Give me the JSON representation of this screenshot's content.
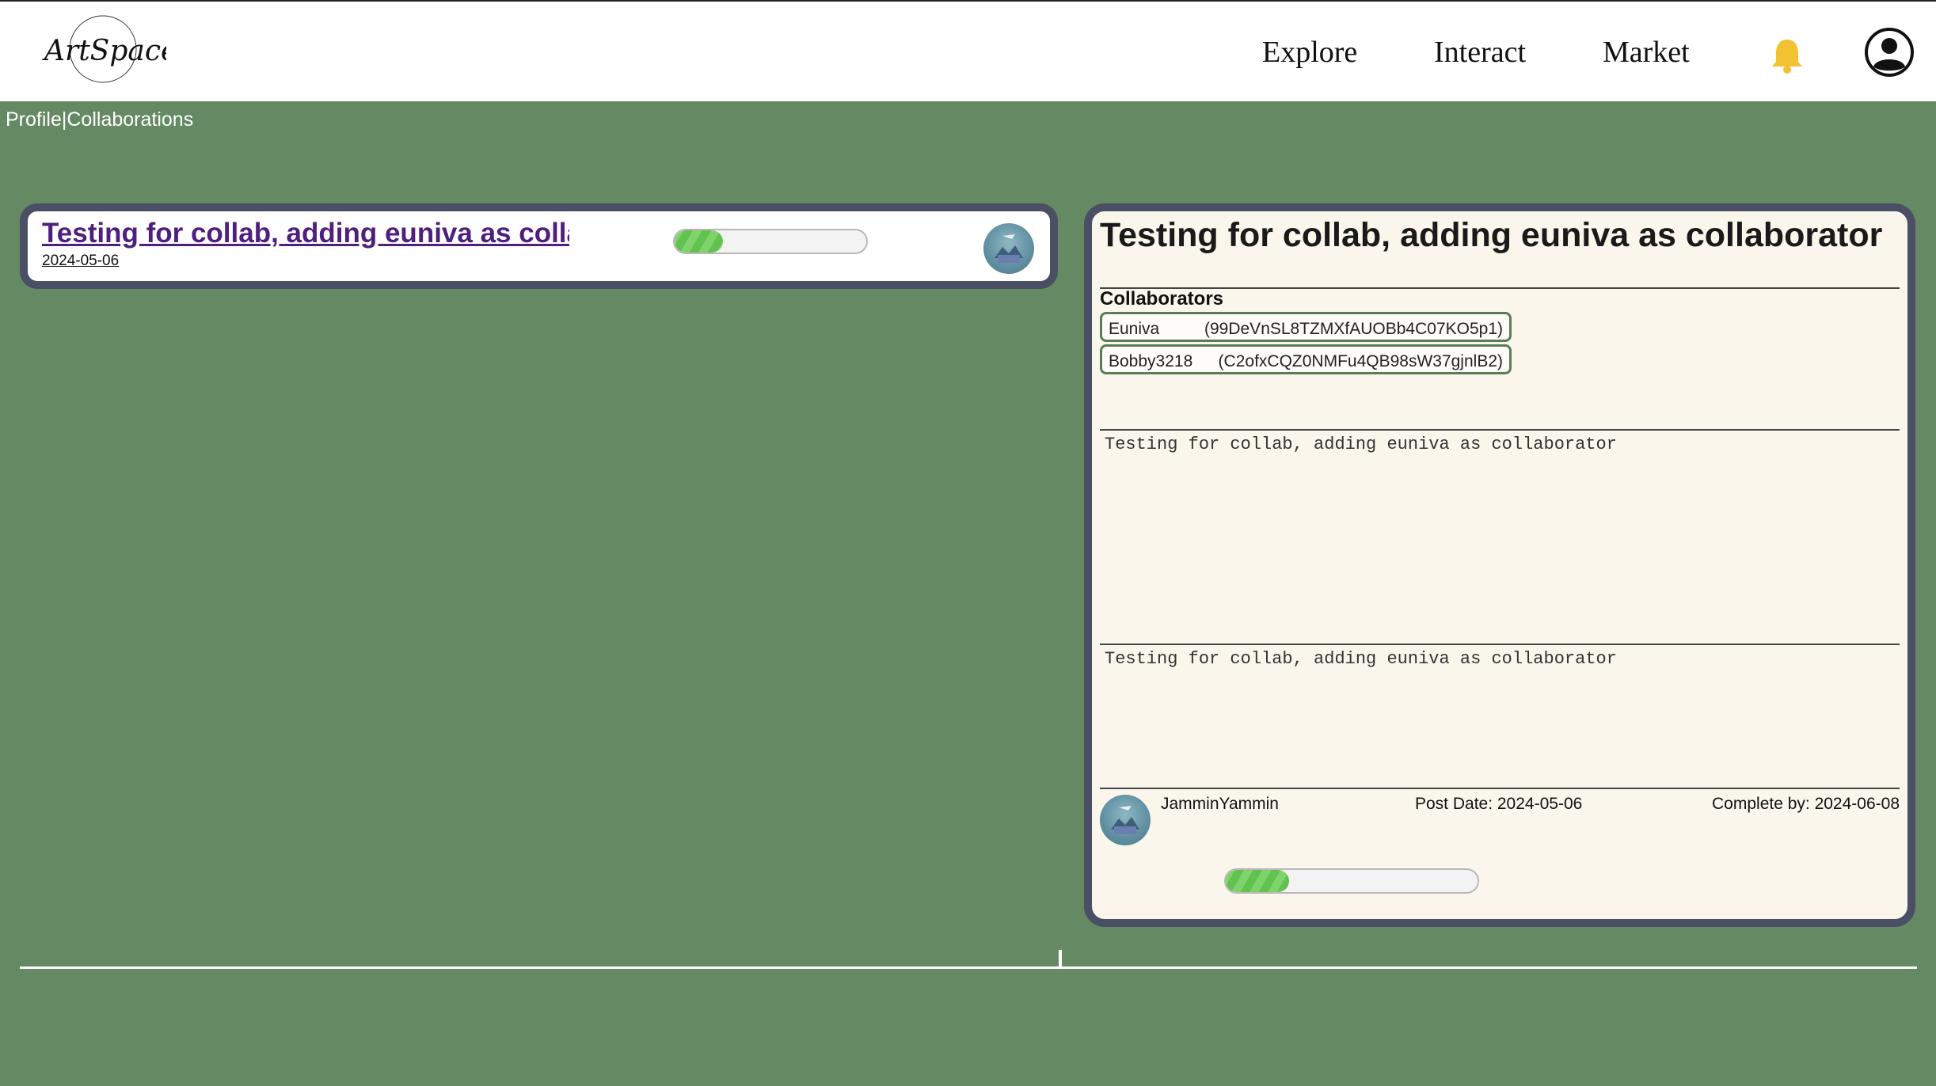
{
  "header": {
    "logo_text": "ArtSpace",
    "nav": [
      "Explore",
      "Interact",
      "Market"
    ]
  },
  "breadcrumb": {
    "profile": "Profile",
    "separator": "|",
    "collaborations": "Collaborations"
  },
  "list": {
    "items": [
      {
        "title": "Testing for collab, adding euniva as collaborator",
        "date": "2024-05-06",
        "progress": 0.25
      }
    ]
  },
  "detail": {
    "title": "Testing for collab, adding euniva as collaborator",
    "collaborators_heading": "Collaborators",
    "collaborators": [
      {
        "name": "Euniva",
        "uid": "(99DeVnSL8TZMXfAUOBb4C07KO5p1)"
      },
      {
        "name": "Bobby3218",
        "uid": "(C2ofxCQZ0NMFu4QB98sW37gjnlB2)"
      }
    ],
    "description_1": "Testing for collab, adding euniva as collaborator",
    "description_2": "Testing for collab, adding euniva as collaborator",
    "owner": "JamminYammin",
    "post_date": "Post Date: 2024-05-06",
    "complete_by": "Complete by: 2024-06-08",
    "progress": 0.25
  },
  "colors": {
    "background": "#658962",
    "card_border": "#4a4f66",
    "panel_bg": "#faf6ec",
    "progress_green": "#6fcb5c",
    "bell": "#f2c232",
    "title_link": "#4e1f7d"
  },
  "icons": {
    "notifications": "bell-icon",
    "account": "user-circle-icon"
  }
}
